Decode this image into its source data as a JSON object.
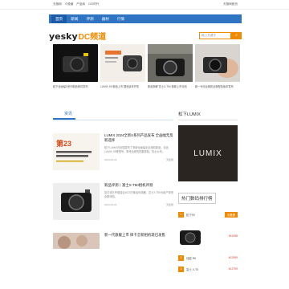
{
  "topbar": {
    "left_links": [
      "天极网",
      "IT频道",
      "产品库",
      "CIO时代"
    ],
    "right_links": [
      "天极网首页"
    ]
  },
  "nav": {
    "items": [
      "首页",
      "新闻",
      "评测",
      "器材",
      "行情"
    ]
  },
  "header": {
    "logo_main": "yesky",
    "logo_sub": "DC频道",
    "search_placeholder": "输入关键字",
    "search_button": "搜索"
  },
  "banner": [
    {
      "caption": "松下全画幅S系列新品即将发布"
    },
    {
      "caption": "LUMIX S9 新品上市 银色版本开售"
    },
    {
      "caption": "新品拆解 富士X-T50 新款上市评测"
    },
    {
      "caption": "新一代无反相机全新配色版本发布"
    }
  ],
  "main": {
    "section_title": "资讯",
    "articles": [
      {
        "title": "LUMIX 2024全新S系列产品发布 全画幅无反新选择",
        "desc": "松下LUMIX在全国发布了多款全画幅无反相机新品，包含LUMIX S9等型号，带来全新的拍摄体验，售价公布。",
        "date": "2024-05-23",
        "source": "天极网"
      },
      {
        "title": "新品评测丨富士X-T50相机评测",
        "desc": "复古设计外观结合4020万像素传感器，富士X-T50为用户带来全新体验。",
        "date": "2024-05-20",
        "source": "天极网"
      },
      {
        "title": "新一代旗舰上市 徕卡全新相机现已发售",
        "desc": "",
        "date": "",
        "source": ""
      }
    ]
  },
  "side": {
    "title": "松下LUMIX",
    "promo_text": "LUMIX",
    "rank_title": "热门数码排行榜",
    "rank_items": [
      {
        "num": "1",
        "name": "松下S9",
        "price": "¥11998",
        "button": "去看看"
      },
      {
        "num": "2",
        "name": "佳能 R6",
        "price": "¥12999",
        "button": "去看看"
      },
      {
        "num": "3",
        "name": "富士 X-T5",
        "price": "¥12799",
        "button": "去看看"
      }
    ]
  }
}
